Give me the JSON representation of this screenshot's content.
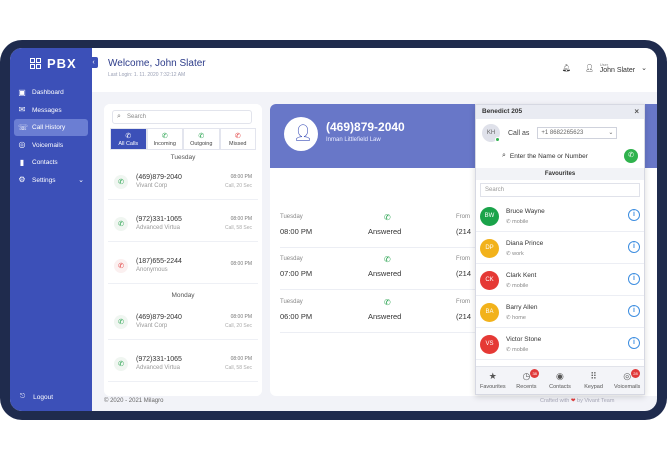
{
  "brand": "PBX",
  "sidebar": {
    "items": [
      {
        "label": "Dashboard",
        "icon": "dashboard-icon"
      },
      {
        "label": "Messages",
        "icon": "messages-icon"
      },
      {
        "label": "Call History",
        "icon": "call-history-icon"
      },
      {
        "label": "Voicemails",
        "icon": "voicemail-icon"
      },
      {
        "label": "Contacts",
        "icon": "contacts-icon"
      },
      {
        "label": "Settings",
        "icon": "gear-icon"
      }
    ],
    "logout": "Logout"
  },
  "header": {
    "welcome": "Welcome, John Slater",
    "last_login": "Last Login: 1. 11. 2020 7:32:12 AM",
    "user_role": "User",
    "user_name": "John Slater"
  },
  "calllist": {
    "search_placeholder": "Search",
    "tabs": [
      "All Calls",
      "Incoming",
      "Outgoing",
      "Missed"
    ],
    "groups": [
      {
        "day": "Tuesday",
        "calls": [
          {
            "number": "(469)879-2040",
            "name": "Vivant Corp",
            "time": "08:00 PM",
            "duration": "Call, 20 Sec",
            "type": "incoming"
          },
          {
            "number": "(972)331-1065",
            "name": "Advanced Virtua",
            "time": "08:00 PM",
            "duration": "Call, 58 Sec",
            "type": "incoming"
          },
          {
            "number": "(187)655-2244",
            "name": "Anonymous",
            "time": "08:00 PM",
            "duration": "",
            "type": "missed"
          }
        ]
      },
      {
        "day": "Monday",
        "calls": [
          {
            "number": "(469)879-2040",
            "name": "Vivant Corp",
            "time": "08:00 PM",
            "duration": "Call, 20 Sec",
            "type": "incoming"
          },
          {
            "number": "(972)331-1065",
            "name": "Advanced Virtua",
            "time": "08:00 PM",
            "duration": "Call, 58 Sec",
            "type": "incoming"
          }
        ]
      }
    ]
  },
  "detail": {
    "number": "(469)879-2040",
    "company": "Inman Littlefield Law",
    "rows": [
      {
        "day": "Tuesday",
        "time": "08:00 PM",
        "status": "Answered",
        "from_label": "From",
        "from_value": "(214"
      },
      {
        "day": "Tuesday",
        "time": "07:00 PM",
        "status": "Answered",
        "from_label": "From",
        "from_value": "(214"
      },
      {
        "day": "Tuesday",
        "time": "06:00 PM",
        "status": "Answered",
        "from_label": "From",
        "from_value": "(214"
      }
    ]
  },
  "footer": {
    "copyright": "© 2020 - 2021 Milagro",
    "crafted": "Crafted with",
    "by": "by Vivant Team"
  },
  "phone": {
    "title": "Benedict 205",
    "avatar": "KH",
    "call_as_label": "Call as",
    "call_as_value": "+1 8682265623",
    "dial_placeholder": "Enter the Name or Number",
    "favourites_label": "Favourites",
    "fav_search_placeholder": "Search",
    "favourites": [
      {
        "initials": "BW",
        "name": "Bruce Wayne",
        "type": "mobile",
        "color": "#1aa34a"
      },
      {
        "initials": "DP",
        "name": "Diana Prince",
        "type": "work",
        "color": "#f2b21b"
      },
      {
        "initials": "CK",
        "name": "Clark Kent",
        "type": "mobile",
        "color": "#e53935"
      },
      {
        "initials": "BA",
        "name": "Barry Allen",
        "type": "home",
        "color": "#f2b21b"
      },
      {
        "initials": "VS",
        "name": "Victor Stone",
        "type": "mobile",
        "color": "#e53935"
      }
    ],
    "tabs": [
      {
        "label": "Favourites",
        "icon": "star-icon",
        "badge": ""
      },
      {
        "label": "Recents",
        "icon": "clock-icon",
        "badge": "38"
      },
      {
        "label": "Contacts",
        "icon": "contacts-icon",
        "badge": ""
      },
      {
        "label": "Keypad",
        "icon": "keypad-icon",
        "badge": ""
      },
      {
        "label": "Voicemails",
        "icon": "voicemail-icon",
        "badge": "28"
      }
    ]
  }
}
